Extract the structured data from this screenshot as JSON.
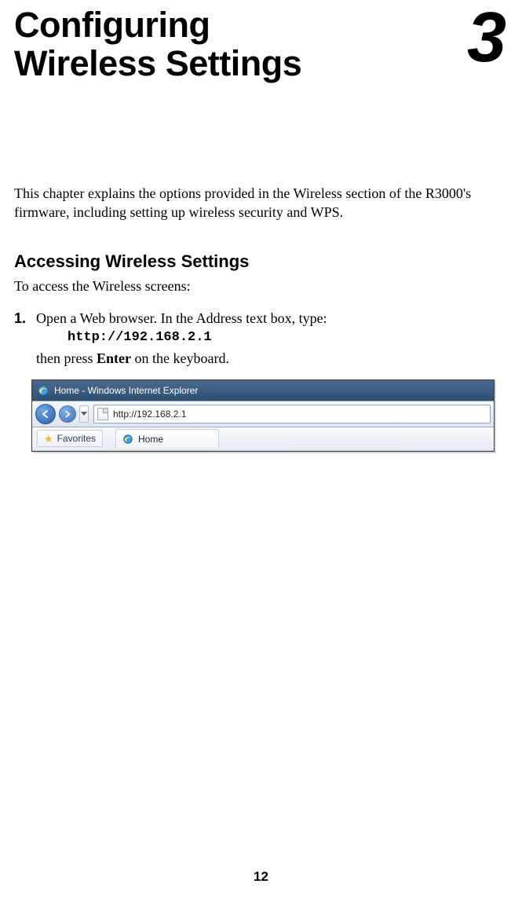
{
  "chapter": {
    "title_line1": "Configuring",
    "title_line2": "Wireless Settings",
    "number": "3"
  },
  "intro": "This chapter explains the options provided in the Wireless section of the R3000's firmware, including setting up wireless security and WPS.",
  "section": {
    "heading": "Accessing Wireless Settings",
    "lead": "To access the Wireless screens:"
  },
  "step1": {
    "num": "1.",
    "line1": "Open a Web browser. In the Address text box, type:",
    "url": "http://192.168.2.1",
    "line2a": "then press ",
    "bold": "Enter",
    "line2b": " on the keyboard."
  },
  "browser": {
    "window_title": "Home - Windows Internet Explorer",
    "address": "http://192.168.2.1",
    "favorites_label": "Favorites",
    "tab_label": "Home"
  },
  "page_number": "12"
}
